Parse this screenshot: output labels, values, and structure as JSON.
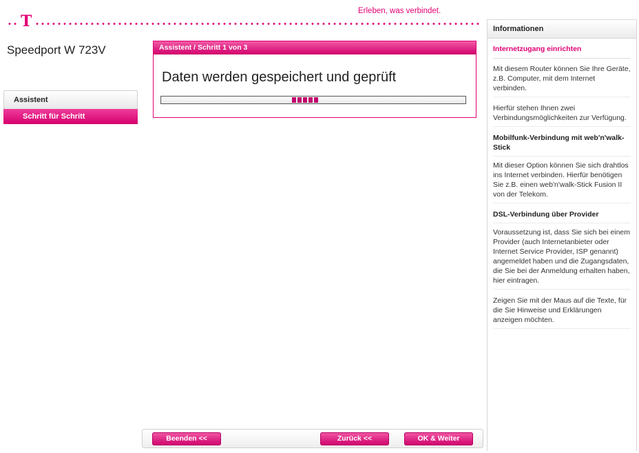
{
  "header": {
    "slogan": "Erleben, was verbindet.",
    "logo_letter": "T",
    "device_name": "Speedport W 723V"
  },
  "nav": {
    "section_label": "Assistent",
    "active_item": "Schritt für Schritt"
  },
  "panel": {
    "header": "Assistent / Schritt 1 von 3",
    "title": "Daten werden gespeichert und geprüft"
  },
  "buttons": {
    "end": "Beenden <<",
    "back": "Zurück <<",
    "next": "OK & Weiter"
  },
  "info": {
    "header": "Informationen",
    "title": "Internetzugang einrichten",
    "p1": "Mit diesem Router können Sie Ihre Geräte, z.B. Computer, mit dem Internet verbinden.",
    "p2": "Hierfür stehen Ihnen zwei Verbindungsmöglichkeiten zur Verfügung.",
    "sub1": "Mobilfunk-Verbindung mit web'n'walk-Stick",
    "p3": "Mit dieser Option können Sie sich drahtlos ins Internet verbinden. Hierfür benötigen Sie z.B. einen web'n'walk-Stick Fusion II von der Telekom.",
    "sub2": "DSL-Verbindung über Provider",
    "p4": "Voraussetzung ist, dass Sie sich bei einem Provider (auch Internetanbieter oder Internet Service Provider, ISP genannt) angemeldet haben und die Zugangsdaten, die Sie bei der Anmeldung erhalten haben, hier eintragen.",
    "p5": "Zeigen Sie mit der Maus auf die Texte, für die Sie Hinweise und Erklärungen anzeigen möchten."
  },
  "colors": {
    "accent": "#e20074"
  }
}
